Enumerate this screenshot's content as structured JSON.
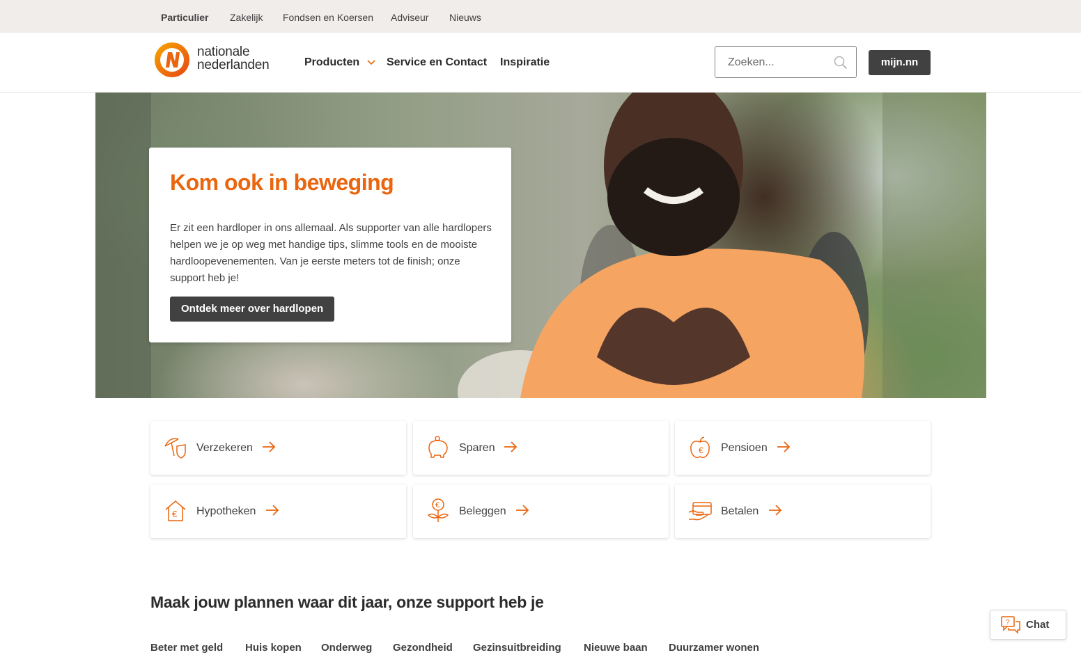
{
  "top_nav": [
    {
      "label": "Particulier",
      "active": true
    },
    {
      "label": "Zakelijk",
      "active": false
    },
    {
      "label": "Fondsen en Koersen",
      "active": false
    },
    {
      "label": "Adviseur",
      "active": false
    },
    {
      "label": "Nieuws",
      "active": false
    }
  ],
  "header": {
    "logo_line1": "nationale",
    "logo_line2": "nederlanden",
    "nav": [
      "Producten",
      "Service en Contact",
      "Inspiratie"
    ],
    "search_placeholder": "Zoeken...",
    "account_button": "mijn.nn"
  },
  "hero": {
    "title": "Kom ook in beweging",
    "body": "Er zit een hardloper in ons allemaal. Als supporter van alle hardlopers helpen we je op weg met handige tips, slimme tools en de mooiste hardloopevenementen. Van je eerste meters tot de finish; onze support heb je!",
    "button": "Ontdek meer over hardlopen"
  },
  "tiles": [
    {
      "label": "Verzekeren",
      "icon": "umbrella-shield-icon"
    },
    {
      "label": "Sparen",
      "icon": "piggy-bank-icon"
    },
    {
      "label": "Pensioen",
      "icon": "apple-euro-icon"
    },
    {
      "label": "Hypotheken",
      "icon": "house-euro-icon"
    },
    {
      "label": "Beleggen",
      "icon": "euro-plant-icon"
    },
    {
      "label": "Betalen",
      "icon": "card-hand-icon"
    }
  ],
  "section": {
    "title": "Maak jouw plannen waar dit jaar, onze support heb je",
    "categories": [
      "Beter met geld",
      "Huis kopen",
      "Onderweg",
      "Gezondheid",
      "Gezinsuitbreiding",
      "Nieuwe baan",
      "Duurzamer wonen"
    ]
  },
  "chat": {
    "label": "Chat"
  },
  "colors": {
    "brand_orange": "#ea650d",
    "dark_button": "#414141",
    "topbar_bg": "#f1edeb"
  }
}
